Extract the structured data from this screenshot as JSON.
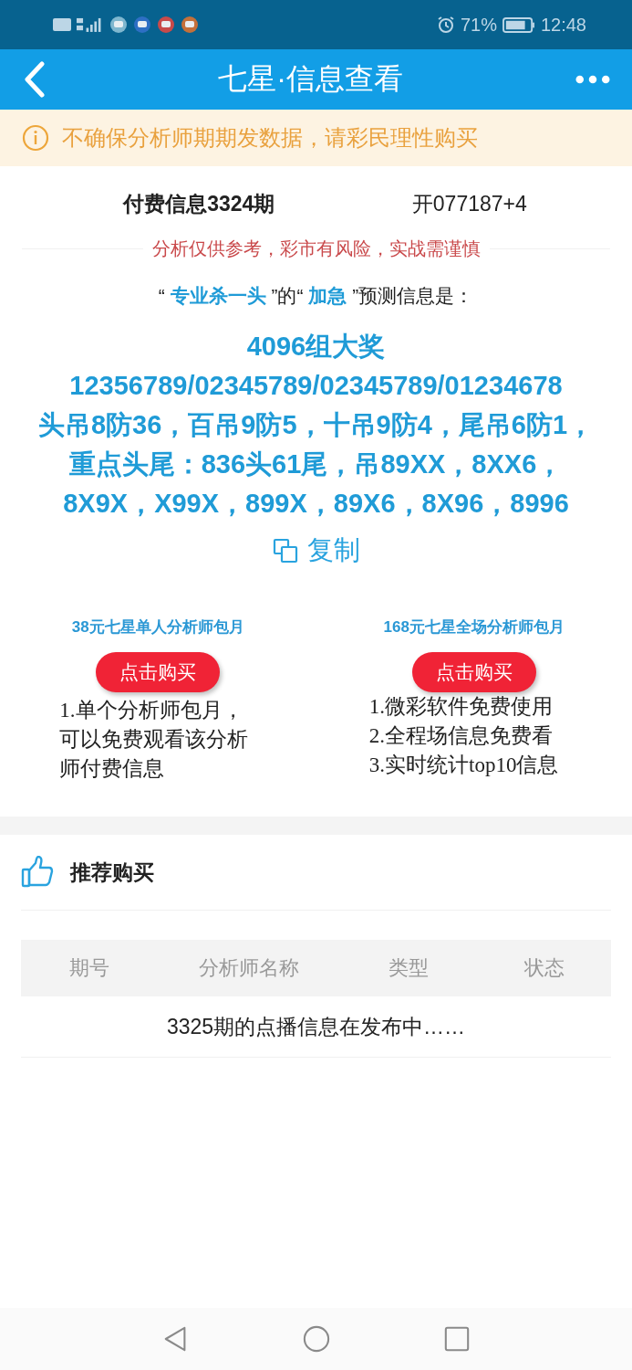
{
  "status_bar": {
    "battery": "71%",
    "time": "12:48"
  },
  "app_bar": {
    "title": "七星·信息查看"
  },
  "notice": {
    "text": "不确保分析师期期发数据，请彩民理性购买"
  },
  "issue": {
    "title": "付费信息3324期",
    "result": "开077187+4"
  },
  "disclaimer": "分析仅供参考，彩市有风险，实战需谨慎",
  "prediction": {
    "heading": "“ **专业杀一头** ”的“ **加急** ”预测信息是：",
    "lines": [
      "4096组大奖",
      "12356789/02345789/02345789/01234678",
      "头吊8防36，百吊9防5，十吊9防4，尾吊6防1，重点头尾：836头61尾，吊89XX，8XX6，8X9X，X99X，899X，89X6，8X96，8996"
    ],
    "copy_label": "复制"
  },
  "plans": [
    {
      "title": "38元七星单人分析师包月",
      "button": "点击购买",
      "features": [
        "1.单个分析师包月，可以免费观看该分析师付费信息"
      ]
    },
    {
      "title": "168元七星全场分析师包月",
      "button": "点击购买",
      "features": [
        "1.微彩软件免费使用",
        "2.全程场信息免费看",
        "3.实时统计top10信息"
      ]
    }
  ],
  "recommend": {
    "title": "推荐购买",
    "table": {
      "columns": [
        "期号",
        "分析师名称",
        "类型",
        "状态"
      ],
      "empty_message": "3325期的点播信息在发布中……"
    }
  }
}
